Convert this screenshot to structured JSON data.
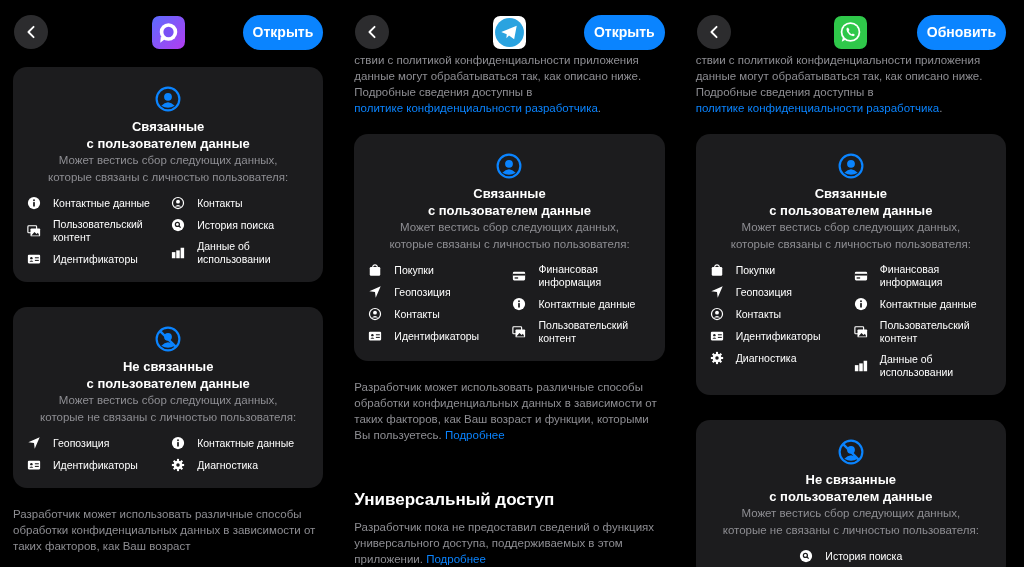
{
  "panels": [
    {
      "app_icon": {
        "kind": "bubble"
      },
      "action_button": "Открыть",
      "blocks": [
        {
          "kind": "linked",
          "title": "Связанные\nс пользователем данные",
          "subtitle": "Может вестись сбор следующих данных,\nкоторые связаны с личностью пользователя:",
          "left": [
            {
              "kind": "info",
              "label": "Контактные данные"
            },
            {
              "kind": "media",
              "label": "Пользовательский контент"
            },
            {
              "kind": "idcard",
              "label": "Идентификаторы"
            }
          ],
          "right": [
            {
              "kind": "contacts",
              "label": "Контакты"
            },
            {
              "kind": "search",
              "label": "История поиска"
            },
            {
              "kind": "usage",
              "label": "Данные об использовании"
            }
          ]
        },
        {
          "kind": "unlinked",
          "title": "Не связанные\nс пользователем данные",
          "subtitle": "Может вестись сбор следующих данных,\nкоторые не связаны с личностью пользователя:",
          "left": [
            {
              "kind": "location",
              "label": "Геопозиция"
            },
            {
              "kind": "idcard",
              "label": "Идентификаторы"
            }
          ],
          "right": [
            {
              "kind": "info",
              "label": "Контактные данные"
            },
            {
              "kind": "gear",
              "label": "Диагностика"
            }
          ]
        },
        {
          "kind": "paragraph",
          "text": "Разработчик может использовать различные способы обработки конфиденциальных данных в зависимости от таких факторов, как Ваш возраст"
        }
      ]
    },
    {
      "app_icon": {
        "kind": "plane"
      },
      "action_button": "Открыть",
      "blocks": [
        {
          "kind": "paragraph",
          "text": "ствии с политикой конфиденциальности приложения данные могут обрабатываться так, как описано ниже. Подробные сведения доступны в",
          "link": "политике конфиденциальности разработчика",
          "after": "."
        },
        {
          "kind": "linked",
          "title": "Связанные\nс пользователем данные",
          "subtitle": "Может вестись сбор следующих данных,\nкоторые связаны с личностью пользователя:",
          "left": [
            {
              "kind": "bag",
              "label": "Покупки"
            },
            {
              "kind": "location",
              "label": "Геопозиция"
            },
            {
              "kind": "contacts",
              "label": "Контакты"
            },
            {
              "kind": "idcard",
              "label": "Идентификаторы"
            }
          ],
          "right": [
            {
              "kind": "creditcard",
              "label": "Финансовая информация"
            },
            {
              "kind": "info",
              "label": "Контактные данные"
            },
            {
              "kind": "media",
              "label": "Пользовательский контент"
            }
          ]
        },
        {
          "kind": "paragraph",
          "text": "Разработчик может использовать различные способы обработки конфиденциальных данных в зависимости от таких факторов, как Ваш возраст и функции, которыми Вы пользуетесь.",
          "link": "Подробнее"
        },
        {
          "kind": "heading",
          "text": "Универсальный доступ"
        },
        {
          "kind": "paragraph",
          "text": "Разработчик пока не предоставил сведений о функциях универсального доступа, поддерживаемых в этом приложении.",
          "link": "Подробнее"
        }
      ]
    },
    {
      "app_icon": {
        "kind": "phone"
      },
      "action_button": "Обновить",
      "blocks": [
        {
          "kind": "paragraph",
          "text": "ствии с политикой конфиденциальности приложения данные могут обрабатываться так, как описано ниже. Подробные сведения доступны в",
          "link": "политике конфиденциальности разработчика",
          "after": "."
        },
        {
          "kind": "linked",
          "title": "Связанные\nс пользователем данные",
          "subtitle": "Может вестись сбор следующих данных,\nкоторые связаны с личностью пользователя:",
          "left": [
            {
              "kind": "bag",
              "label": "Покупки"
            },
            {
              "kind": "location",
              "label": "Геопозиция"
            },
            {
              "kind": "contacts",
              "label": "Контакты"
            },
            {
              "kind": "idcard",
              "label": "Идентификаторы"
            },
            {
              "kind": "gear",
              "label": "Диагностика"
            }
          ],
          "right": [
            {
              "kind": "creditcard",
              "label": "Финансовая информация"
            },
            {
              "kind": "info",
              "label": "Контактные данные"
            },
            {
              "kind": "media",
              "label": "Пользовательский контент"
            },
            {
              "kind": "usage",
              "label": "Данные об использовании"
            }
          ]
        },
        {
          "kind": "unlinked",
          "title": "Не связанные\nс пользователем данные",
          "subtitle": "Может вестись сбор следующих данных,\nкоторые не связаны с личностью пользователя:",
          "left": [
            {
              "kind": "search",
              "label": "История поиска"
            }
          ]
        }
      ]
    }
  ]
}
